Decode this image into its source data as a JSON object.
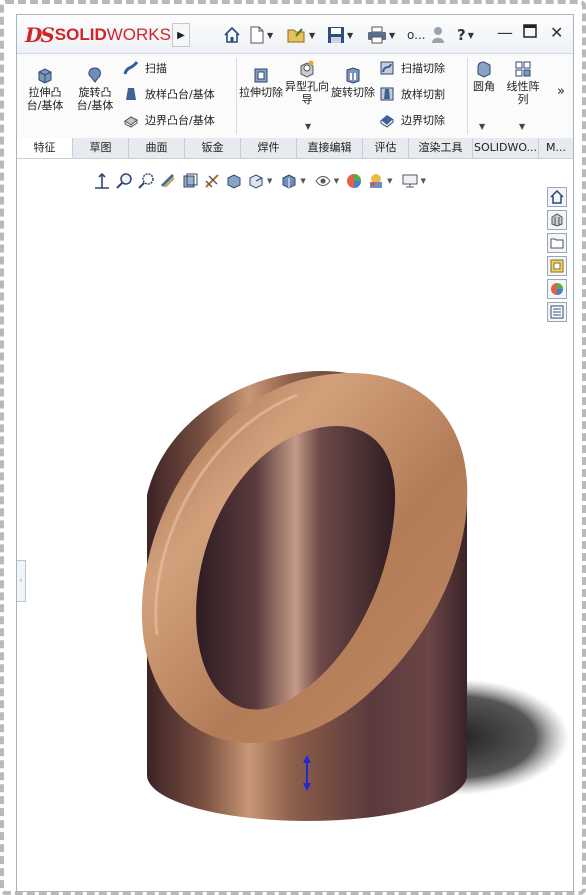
{
  "app": {
    "logo_ds": "DS",
    "logo_solid": "SOLID",
    "logo_works": "WORKS",
    "truncated_label": "o...",
    "help_label": "?"
  },
  "ribbon": {
    "extrude_boss": "拉伸凸台/基体",
    "revolve_boss": "旋转凸台/基体",
    "sweep": "扫描",
    "loft_boss": "放样凸台/基体",
    "boundary_boss": "边界凸台/基体",
    "extrude_cut": "拉伸切除",
    "hole_wizard": "异型孔向导",
    "revolve_cut": "旋转切除",
    "swept_cut": "扫描切除",
    "lofted_cut": "放样切割",
    "boundary_cut": "边界切除",
    "fillet": "圆角",
    "linear_pattern": "线性阵列",
    "more": "»"
  },
  "tabs": [
    "特征",
    "草图",
    "曲面",
    "钣金",
    "焊件",
    "直接编辑",
    "评估",
    "渲染工具",
    "SOLIDWO...",
    "M..."
  ],
  "colors": {
    "brand": "#d1232a",
    "copper": "#b9825c",
    "part_dark": "#4a2f33"
  },
  "icons": {
    "home": "home-icon",
    "new": "new-document-icon",
    "open": "open-icon",
    "save": "save-icon",
    "print": "print-icon",
    "user": "user-icon"
  }
}
